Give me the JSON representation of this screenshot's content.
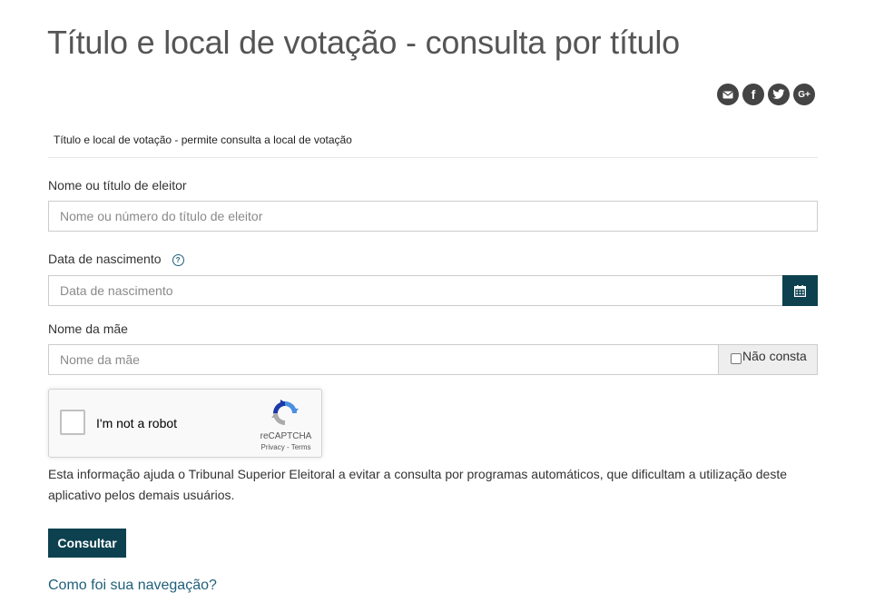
{
  "page": {
    "title": "Título e local de votação - consulta por título",
    "subtitle": "Título e local de votação - permite consulta a local de votação"
  },
  "share": {
    "icons": [
      "envelope-icon",
      "facebook-icon",
      "twitter-icon",
      "google-plus-icon"
    ],
    "google_plus_text": "G+",
    "facebook_text": "f",
    "color": "#444444"
  },
  "form": {
    "name_label": "Nome ou título de eleitor",
    "name_placeholder": "Nome ou número do título de eleitor",
    "name_value": "",
    "birth_label": "Data de nascimento",
    "birth_help_icon": "question-circle-icon",
    "birth_help_glyph": "?",
    "birth_placeholder": "Data de nascimento",
    "birth_value": "",
    "calendar_icon": "calendar-icon",
    "mother_label": "Nome da mãe",
    "mother_placeholder": "Nome da mãe",
    "mother_value": "",
    "nao_consta_label": "Não consta",
    "nao_consta_checked": false
  },
  "recaptcha": {
    "label": "I'm not a robot",
    "brand": "reCAPTCHA",
    "terms": "Privacy - Terms",
    "checked": false
  },
  "info_text": "Esta informação ajuda o Tribunal Superior Eleitoral a evitar a consulta por programas automáticos, que dificultam a utilização deste aplicativo pelos demais usuários.",
  "submit_label": "Consultar",
  "feedback_link": "Como foi sua navegação?",
  "colors": {
    "primary": "#0d4150",
    "link": "#1f5f7a",
    "title": "#555555"
  }
}
